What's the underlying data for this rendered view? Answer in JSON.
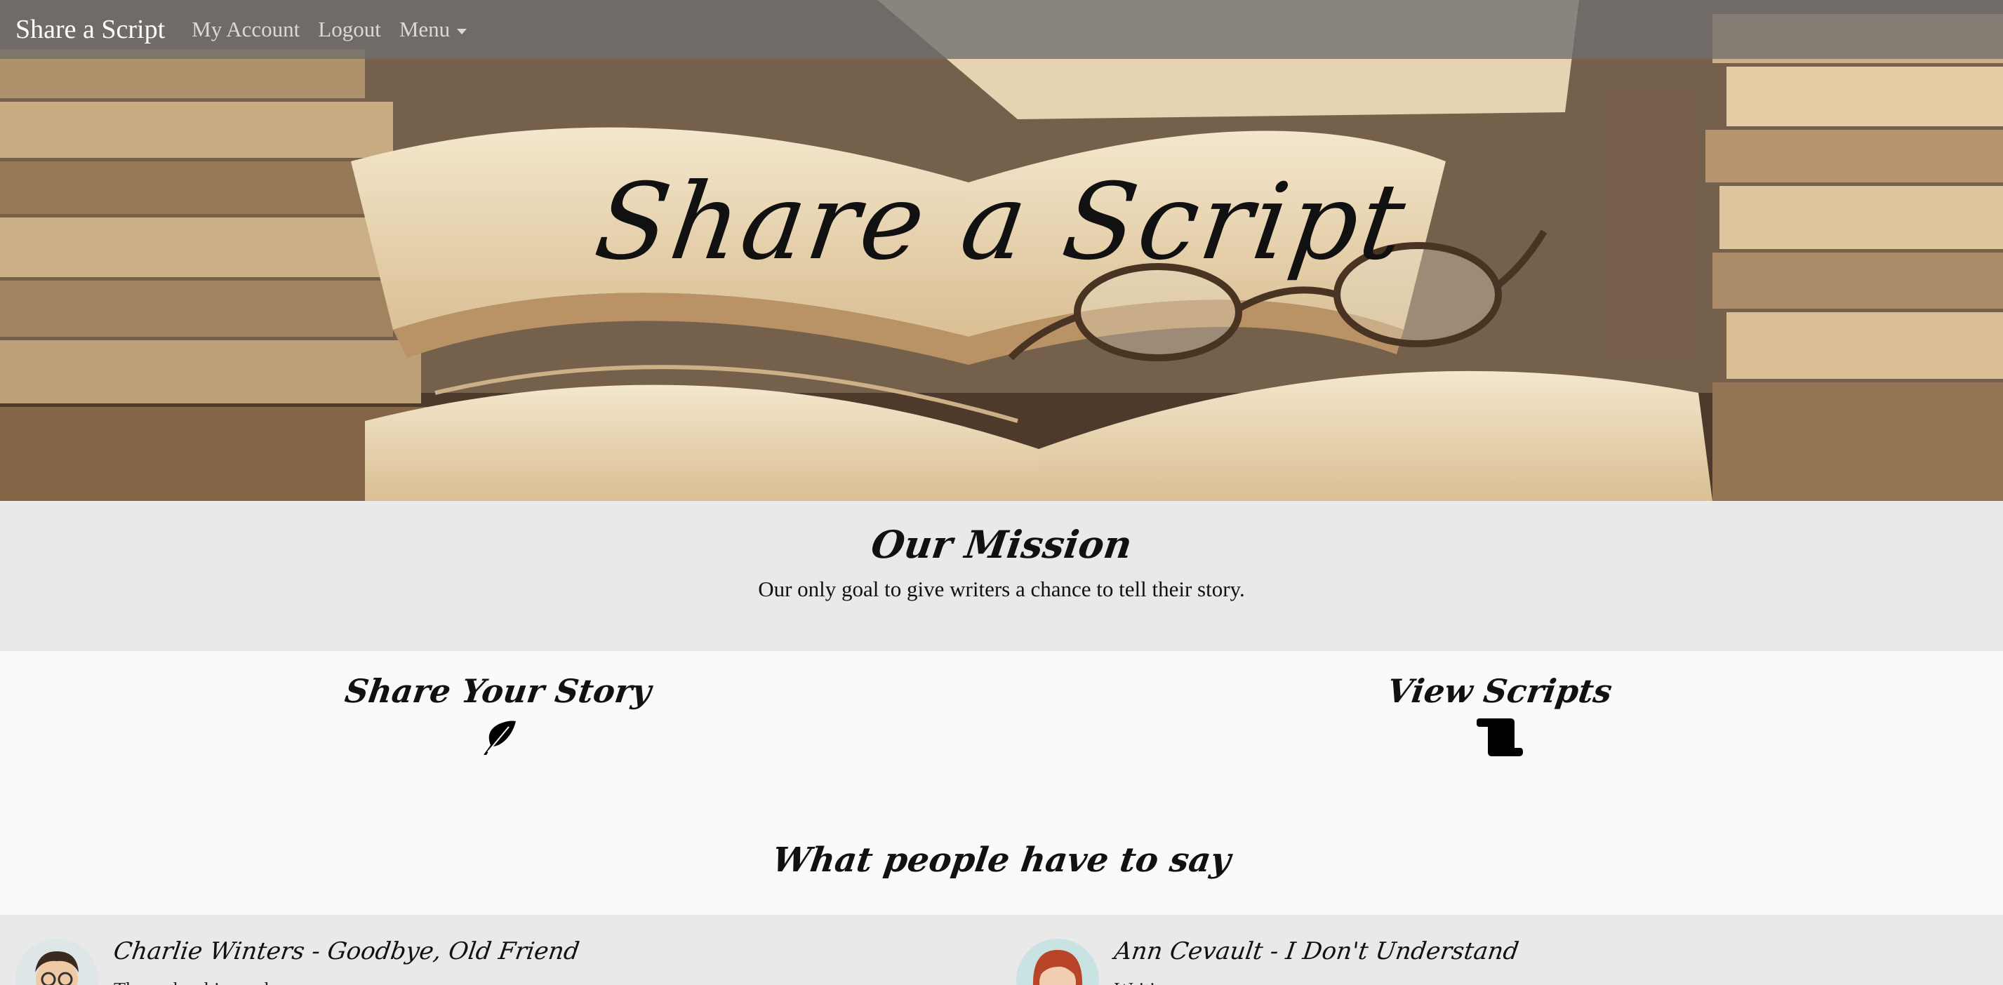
{
  "navbar": {
    "brand": "Share a Script",
    "links": [
      "My Account",
      "Logout"
    ],
    "menu_label": "Menu",
    "menu_icon": "caret-down-icon"
  },
  "hero": {
    "title": "Share a Script",
    "background": "open books and reading glasses on a wooden desk"
  },
  "mission": {
    "heading": "Our Mission",
    "text": "Our only goal to give writers a chance to tell their story."
  },
  "features": [
    {
      "label": "Share Your Story",
      "icon": "feather-icon"
    },
    {
      "label": "View Scripts",
      "icon": "scroll-icon"
    }
  ],
  "testimonials": {
    "heading": "What people have to say",
    "items": [
      {
        "title": "Charlie Winters - Goodbye, Old Friend",
        "body": "The author biography ...",
        "avatar": "avatar-man-glasses-icon"
      },
      {
        "title": "Ann Cevault - I Don't Understand",
        "body": "Writing ...",
        "avatar": "avatar-redhead-woman-icon"
      }
    ]
  },
  "colors": {
    "navbar_bg": "#6e6e6e",
    "mission_bg": "#e9e9e9",
    "page_bg": "#fafafa",
    "text": "#111111"
  }
}
